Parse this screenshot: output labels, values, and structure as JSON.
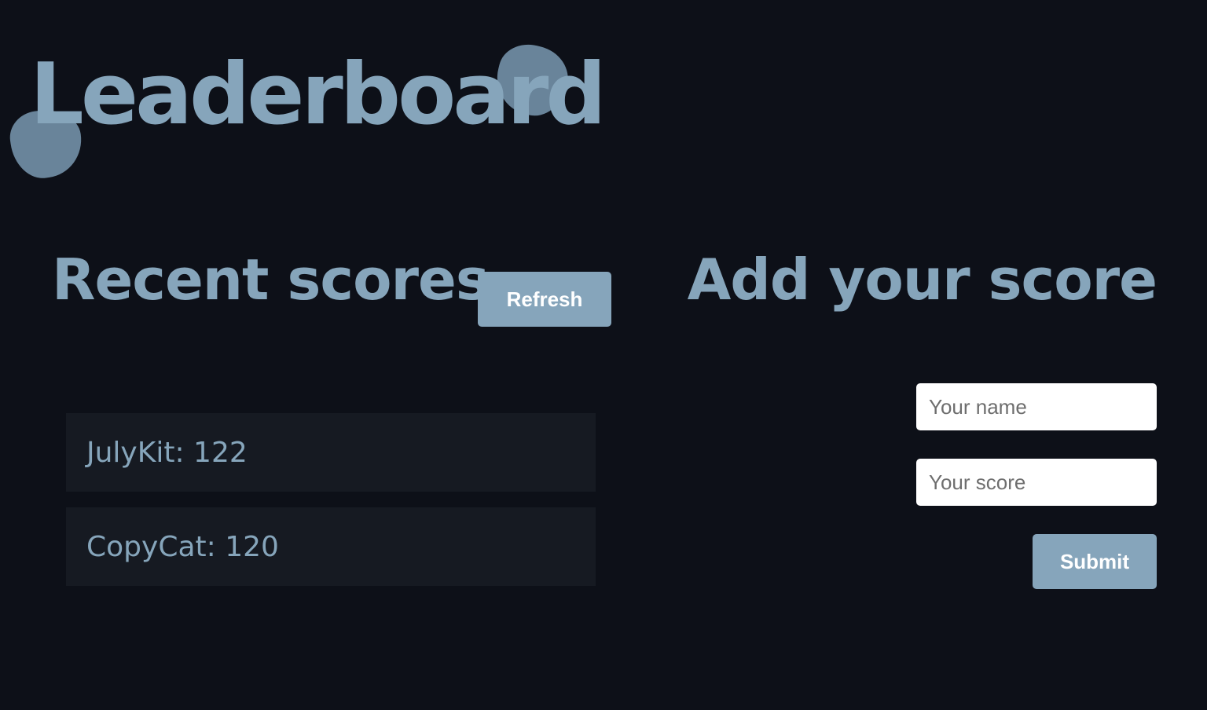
{
  "page": {
    "title": "Leaderboard"
  },
  "recent": {
    "heading": "Recent scores",
    "refresh_label": "Refresh",
    "scores": [
      {
        "text": "JulyKit: 122"
      },
      {
        "text": "CopyCat: 120"
      }
    ]
  },
  "add": {
    "heading": "Add your score",
    "name_placeholder": "Your name",
    "name_value": "",
    "score_placeholder": "Your score",
    "score_value": "",
    "submit_label": "Submit"
  },
  "colors": {
    "background": "#0d1018",
    "accent": "#86a5bb",
    "blob": "#6f8ba1",
    "list_item_bg": "#161a22",
    "button_text": "#ffffff",
    "input_bg": "#ffffff"
  }
}
